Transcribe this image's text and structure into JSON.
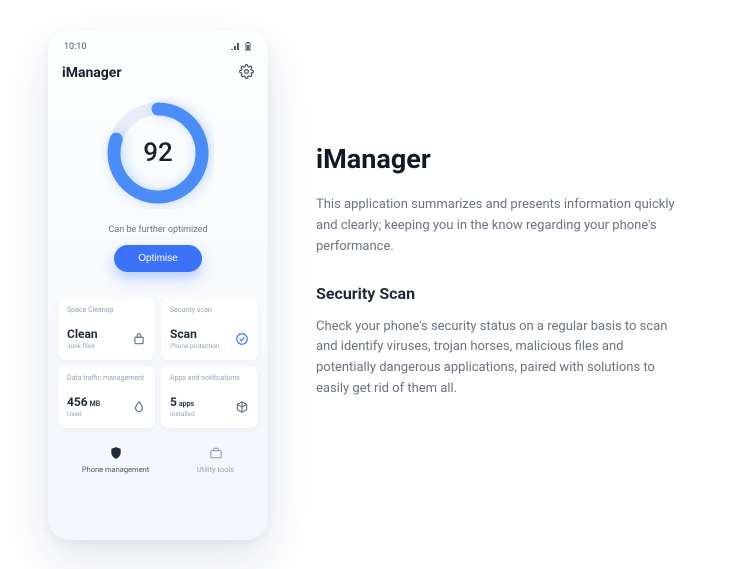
{
  "phone": {
    "status": {
      "time": "10:10"
    },
    "app": {
      "title": "iManager"
    },
    "score": {
      "value": "92",
      "percent": 80,
      "hint": "Can be further optimized",
      "cta": "Optimise"
    },
    "cards": {
      "cleanup": {
        "label": "Space Cleanup",
        "value": "Clean",
        "sub": "Junk files"
      },
      "security": {
        "label": "Security scan",
        "value": "Scan",
        "sub": "Phone protection"
      },
      "traffic": {
        "label": "Data traffic management",
        "value": "456",
        "unit": "MB",
        "sub": "Used"
      },
      "apps": {
        "label": "Apps and notifications",
        "value": "5",
        "unit": "apps",
        "sub": "Installed"
      }
    },
    "nav": {
      "management": "Phone management",
      "utility": "Utility tools"
    }
  },
  "copy": {
    "h1": "iManager",
    "p1": "This application summarizes and presents information quickly and clearly; keeping you in the know regarding your phone's performance.",
    "h2": "Security Scan",
    "p2": "Check your phone's security status on a regular basis to scan and identify viruses, trojan horses, malicious files and potentially dangerous applications, paired with solutions to easily get rid of them all."
  }
}
